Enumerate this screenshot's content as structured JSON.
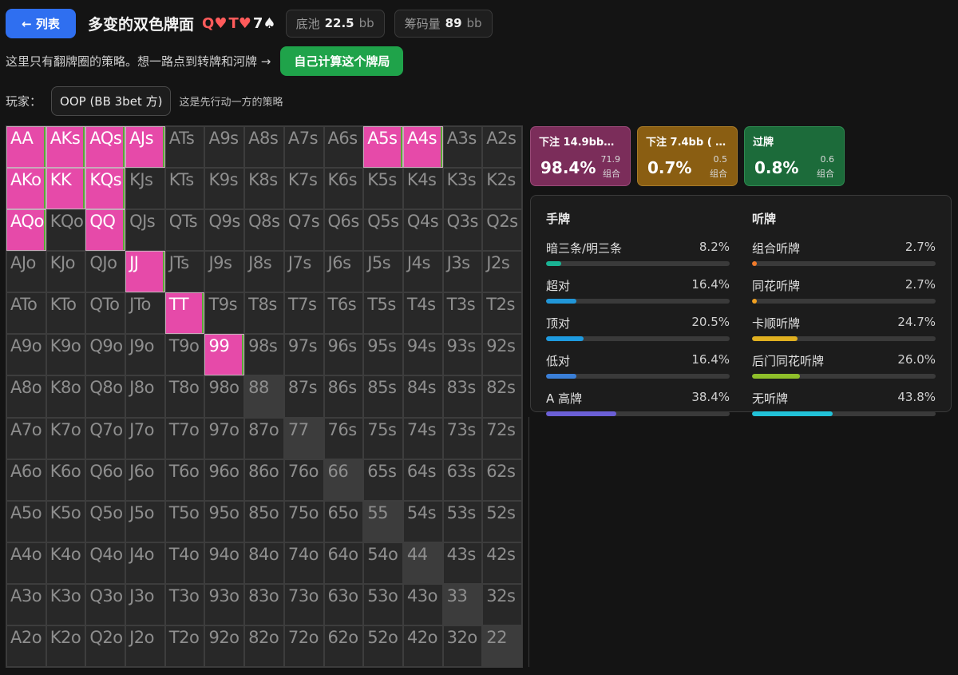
{
  "header": {
    "back_label": "← 列表",
    "title": "多变的双色牌面",
    "board": [
      {
        "rank": "Q",
        "suit": "♥",
        "color": "red"
      },
      {
        "rank": "T",
        "suit": "♥",
        "color": "red"
      },
      {
        "rank": "7",
        "suit": "♠",
        "color": "black"
      }
    ],
    "pot": {
      "label": "底池",
      "value": "22.5",
      "unit": "bb"
    },
    "stack": {
      "label": "筹码量",
      "value": "89",
      "unit": "bb"
    }
  },
  "note": {
    "text": "这里只有翻牌圈的策略。想一路点到转牌和河牌 →",
    "button_label": "自己计算这个牌局"
  },
  "player": {
    "label": "玩家：",
    "selected": "OOP (BB 3bet 方)",
    "hint": "这是先行动一方的策略"
  },
  "colors": {
    "highlight": "#e64aa9",
    "bet_big": "#7b2d5a",
    "bet_small": "#8a5e12",
    "check": "#1c6b3a",
    "accent_blue": "#2f6ff0",
    "accent_green": "#1fa34a"
  },
  "grid": {
    "ranks": [
      "A",
      "K",
      "Q",
      "J",
      "T",
      "9",
      "8",
      "7",
      "6",
      "5",
      "4",
      "3",
      "2"
    ],
    "highlighted": [
      "AA",
      "AKs",
      "AQs",
      "AJs",
      "A5s",
      "A4s",
      "AKo",
      "KK",
      "KQs",
      "AQo",
      "QQ",
      "JJ",
      "TT",
      "99"
    ]
  },
  "actions": [
    {
      "label": "下注 14.9bb…",
      "pct": "98.4%",
      "combos": "71.9",
      "combos_label": "组合",
      "kind": "bet-big"
    },
    {
      "label": "下注 7.4bb ( …",
      "pct": "0.7%",
      "combos": "0.5",
      "combos_label": "组合",
      "kind": "bet-small"
    },
    {
      "label": "过牌",
      "pct": "0.8%",
      "combos": "0.6",
      "combos_label": "组合",
      "kind": "check"
    }
  ],
  "stats": {
    "hands": {
      "title": "手牌",
      "rows": [
        {
          "label": "暗三条/明三条",
          "value": "8.2%",
          "fraction": 0.082,
          "color": "#1ab394"
        },
        {
          "label": "超对",
          "value": "16.4%",
          "fraction": 0.164,
          "color": "#2196d8"
        },
        {
          "label": "顶对",
          "value": "20.5%",
          "fraction": 0.205,
          "color": "#1e9be0"
        },
        {
          "label": "低对",
          "value": "16.4%",
          "fraction": 0.164,
          "color": "#3a7fd8"
        },
        {
          "label": "A 高牌",
          "value": "38.4%",
          "fraction": 0.384,
          "color": "#6b5fd6"
        }
      ]
    },
    "draws": {
      "title": "听牌",
      "rows": [
        {
          "label": "组合听牌",
          "value": "2.7%",
          "fraction": 0.027,
          "color": "#f07a2a"
        },
        {
          "label": "同花听牌",
          "value": "2.7%",
          "fraction": 0.027,
          "color": "#f0a020"
        },
        {
          "label": "卡顺听牌",
          "value": "24.7%",
          "fraction": 0.247,
          "color": "#e0b020"
        },
        {
          "label": "后门同花听牌",
          "value": "26.0%",
          "fraction": 0.26,
          "color": "#8fbf2a"
        },
        {
          "label": "无听牌",
          "value": "43.8%",
          "fraction": 0.438,
          "color": "#22c2d8"
        }
      ]
    }
  }
}
